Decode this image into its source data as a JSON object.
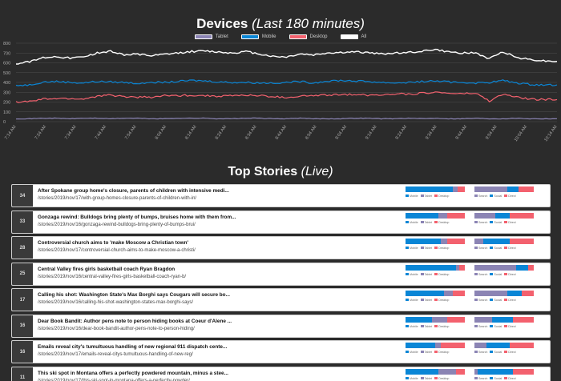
{
  "header": {
    "title": "Devices",
    "subtitle": "(Last 180 minutes)"
  },
  "colors": {
    "tablet": "#8b84b4",
    "mobile": "#0a86d6",
    "desktop": "#f3616e",
    "all": "#ffffff",
    "grid": "#555555",
    "axis_text": "#aaaaaa"
  },
  "legend": [
    {
      "key": "tablet",
      "label": "Tablet"
    },
    {
      "key": "mobile",
      "label": "Mobile"
    },
    {
      "key": "desktop",
      "label": "Desktop"
    },
    {
      "key": "all",
      "label": "All"
    }
  ],
  "chart_data": {
    "type": "line",
    "yticks": [
      0,
      100,
      200,
      300,
      400,
      500,
      600,
      700,
      800
    ],
    "ylim": [
      0,
      800
    ],
    "xticks": [
      "7:14 AM",
      "7:24 AM",
      "7:34 AM",
      "7:44 AM",
      "7:54 AM",
      "8:04 AM",
      "8:14 AM",
      "8:24 AM",
      "8:34 AM",
      "8:44 AM",
      "8:54 AM",
      "9:04 AM",
      "9:14 AM",
      "9:24 AM",
      "9:34 AM",
      "9:44 AM",
      "9:54 AM",
      "10:04 AM",
      "10:14 AM"
    ],
    "series": [
      {
        "name": "All",
        "key": "all",
        "values": [
          590,
          610,
          655,
          665,
          650,
          660,
          700,
          720,
          680,
          690,
          670,
          685,
          700,
          715,
          720,
          710,
          700,
          715,
          690,
          665,
          660,
          690,
          680,
          700,
          705,
          710,
          705,
          690,
          700,
          705,
          720,
          735,
          710,
          700,
          700,
          640,
          715,
          655,
          635,
          620,
          615
        ]
      },
      {
        "name": "Mobile",
        "key": "mobile",
        "values": [
          370,
          375,
          405,
          410,
          400,
          395,
          410,
          405,
          400,
          390,
          405,
          400,
          410,
          420,
          415,
          405,
          400,
          400,
          395,
          395,
          400,
          410,
          395,
          415,
          420,
          415,
          410,
          400,
          395,
          400,
          410,
          415,
          405,
          400,
          395,
          400,
          420,
          395,
          380,
          375,
          375
        ]
      },
      {
        "name": "Desktop",
        "key": "desktop",
        "values": [
          200,
          205,
          230,
          235,
          235,
          230,
          260,
          270,
          255,
          250,
          250,
          265,
          265,
          270,
          265,
          260,
          265,
          270,
          265,
          255,
          245,
          260,
          265,
          270,
          275,
          280,
          270,
          275,
          285,
          280,
          290,
          300,
          290,
          285,
          290,
          210,
          280,
          250,
          230,
          225,
          225
        ]
      },
      {
        "name": "Tablet",
        "key": "tablet",
        "values": [
          30,
          30,
          35,
          35,
          30,
          35,
          35,
          30,
          35,
          35,
          30,
          30,
          35,
          35,
          35,
          30,
          30,
          35,
          35,
          30,
          30,
          35,
          30,
          30,
          30,
          35,
          35,
          30,
          30,
          35,
          30,
          35,
          30,
          30,
          35,
          30,
          30,
          35,
          30,
          30,
          30
        ]
      }
    ]
  },
  "top_stories": {
    "title": "Top Stories",
    "subtitle": "(Live)"
  },
  "stories": [
    {
      "rank": "34",
      "headline": "After Spokane group home's closure, parents of children with intensive medi...",
      "path": "/stories/2019/nov/17/with-group-homes-closure-parents-of-children-with-in/",
      "devices": [
        80,
        8,
        12
      ],
      "referrers": [
        55,
        20,
        25
      ]
    },
    {
      "rank": "33",
      "headline": "Gonzaga rewind: Bulldogs bring plenty of bumps, bruises home with them from...",
      "path": "/stories/2019/nov/16/gonzaga-rewind-bulldogs-bring-plenty-of-bumps-brui/",
      "devices": [
        55,
        15,
        30
      ],
      "referrers": [
        35,
        25,
        40
      ]
    },
    {
      "rank": "28",
      "headline": "Controversial church aims to 'make Moscow a Christian town'",
      "path": "/stories/2019/nov/17/controversial-church-aims-to-make-moscow-a-christi/",
      "devices": [
        60,
        10,
        30
      ],
      "referrers": [
        15,
        45,
        40
      ]
    },
    {
      "rank": "25",
      "headline": "Central Valley fires girls basketball coach Ryan Bragdon",
      "path": "/stories/2019/nov/16/central-valley-fires-girls-basketball-coach-ryan-b/",
      "devices": [
        85,
        5,
        10
      ],
      "referrers": [
        70,
        20,
        10
      ]
    },
    {
      "rank": "17",
      "headline": "Calling his shot: Washington State's Max Borghi says Cougars will secure bo...",
      "path": "/stories/2019/nov/16/calling-his-shot-washington-states-max-borghi-says/",
      "devices": [
        65,
        15,
        20
      ],
      "referrers": [
        55,
        25,
        20
      ]
    },
    {
      "rank": "16",
      "headline": "Dear Book Bandit: Author pens note to person hiding books at Coeur d'Alene ...",
      "path": "/stories/2019/nov/16/dear-book-bandit-author-pens-note-to-person-hiding/",
      "devices": [
        45,
        25,
        30
      ],
      "referrers": [
        30,
        35,
        35
      ]
    },
    {
      "rank": "16",
      "headline": "Emails reveal city's tumultuous handling of new regional 911 dispatch cente...",
      "path": "/stories/2019/nov/17/emails-reveal-citys-tumultuous-handling-of-new-reg/",
      "devices": [
        50,
        10,
        40
      ],
      "referrers": [
        20,
        40,
        40
      ]
    },
    {
      "rank": "11",
      "headline": "This ski spot in Montana offers a perfectly powdered mountain, minus a stee...",
      "path": "/stories/2019/nov/17/this-ski-spot-in-montana-offers-a-perfectly-powder/",
      "devices": [
        55,
        30,
        15
      ],
      "referrers": [
        5,
        60,
        35
      ]
    }
  ],
  "mini_legend": {
    "devices": [
      "Mobile",
      "Tablet",
      "Desktop"
    ],
    "referrers": [
      "Search",
      "Social",
      "Direct"
    ]
  }
}
